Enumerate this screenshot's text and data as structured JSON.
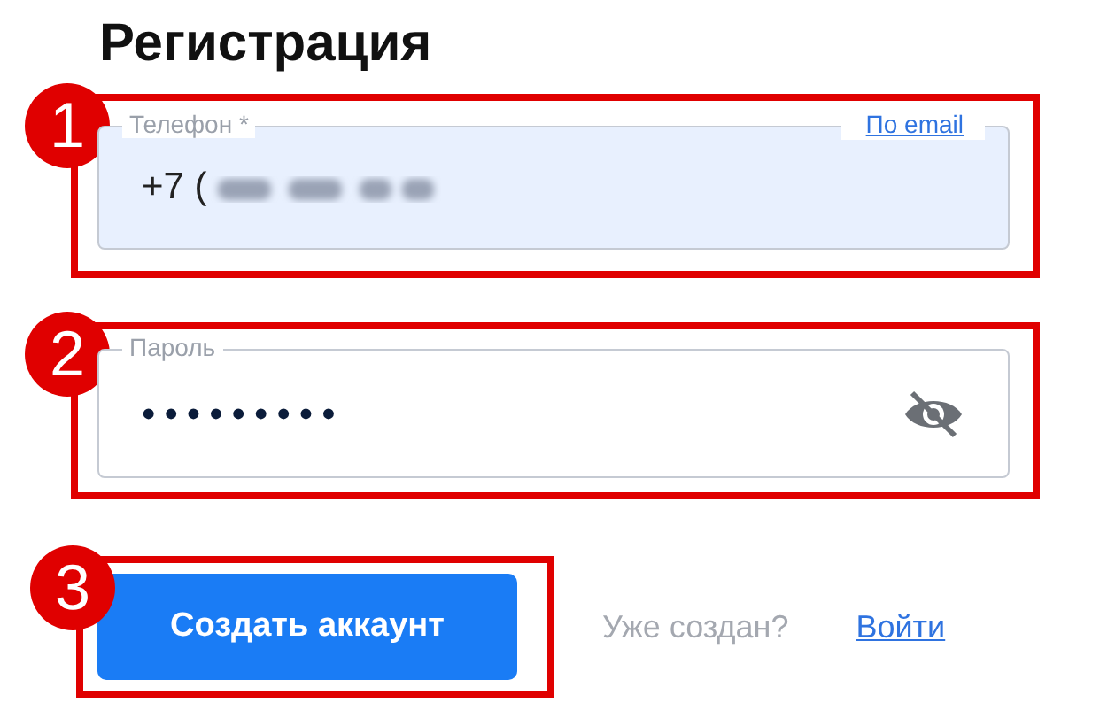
{
  "title": "Регистрация",
  "phone_field": {
    "marker": "1",
    "label": "Телефон *",
    "value": "+7 (",
    "link": "По email"
  },
  "password_field": {
    "marker": "2",
    "label": "Пароль",
    "value": "•••••••••",
    "password_visible": false
  },
  "actions": {
    "marker": "3",
    "button": "Создать аккаунт",
    "prompt": "Уже создан?",
    "link": "Войти"
  }
}
